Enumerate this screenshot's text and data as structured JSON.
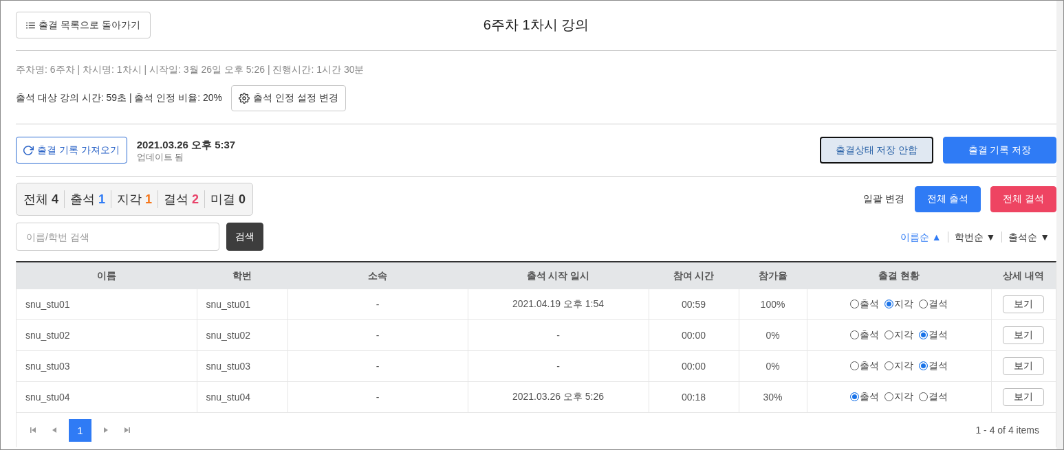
{
  "header": {
    "back_button": "출결 목록으로 돌아가기",
    "title": "6주차 1차시 강의"
  },
  "info": {
    "session_line": "주차명: 6주차 | 차시명: 1차시 | 시작일: 3월 26일 오후 5:26 | 진행시간: 1시간 30분",
    "criteria_line": "출석 대상 강의 시간: 59초 | 출석 인정 비율: 20%",
    "settings_button": "출석 인정 설정 변경"
  },
  "sync": {
    "fetch_button": "출결 기록 가져오기",
    "updated_time": "2021.03.26 오후 5:37",
    "updated_label": "업데이트 됨",
    "discard_button": {
      "label": "출결상태 저장 안함",
      "focused": true
    },
    "save_button": "출결 기록 저장"
  },
  "summary": [
    {
      "label": "전체",
      "count": "4",
      "color": "#333333"
    },
    {
      "label": "출석",
      "count": "1",
      "color": "#2f7bf5"
    },
    {
      "label": "지각",
      "count": "1",
      "color": "#f5761a"
    },
    {
      "label": "결석",
      "count": "2",
      "color": "#e8436a"
    },
    {
      "label": "미결",
      "count": "0",
      "color": "#333333"
    }
  ],
  "bulk_change": {
    "label": "일괄 변경",
    "buttons": [
      {
        "label": "전체 출석",
        "kind": "primary"
      },
      {
        "label": "전체 결석",
        "kind": "danger"
      }
    ]
  },
  "search": {
    "placeholder": "이름/학번 검색",
    "button": "검색"
  },
  "sort_options": [
    {
      "label": "이름순 ▲",
      "selected": true
    },
    {
      "label": "학번순 ▼",
      "selected": false
    },
    {
      "label": "출석순 ▼",
      "selected": false
    }
  ],
  "table": {
    "columns": [
      "이름",
      "학번",
      "소속",
      "출석 시작 일시",
      "참여 시간",
      "참가율",
      "출결 현황",
      "상세 내역"
    ],
    "rows": [
      {
        "name": "snu_stu01",
        "student_id": "snu_stu01",
        "affiliation": "-",
        "start_time": "2021.04.19 오후 1:54",
        "duration": "00:59",
        "rate": "100%",
        "attendance": [
          {
            "label": "출석",
            "selected": false
          },
          {
            "label": "지각",
            "selected": true
          },
          {
            "label": "결석",
            "selected": false
          }
        ],
        "detail_button": "보기"
      },
      {
        "name": "snu_stu02",
        "student_id": "snu_stu02",
        "affiliation": "-",
        "start_time": "-",
        "duration": "00:00",
        "rate": "0%",
        "attendance": [
          {
            "label": "출석",
            "selected": false
          },
          {
            "label": "지각",
            "selected": false
          },
          {
            "label": "결석",
            "selected": true
          }
        ],
        "detail_button": "보기"
      },
      {
        "name": "snu_stu03",
        "student_id": "snu_stu03",
        "affiliation": "-",
        "start_time": "-",
        "duration": "00:00",
        "rate": "0%",
        "attendance": [
          {
            "label": "출석",
            "selected": false
          },
          {
            "label": "지각",
            "selected": false
          },
          {
            "label": "결석",
            "selected": true
          }
        ],
        "detail_button": "보기"
      },
      {
        "name": "snu_stu04",
        "student_id": "snu_stu04",
        "affiliation": "-",
        "start_time": "2021.03.26 오후 5:26",
        "duration": "00:18",
        "rate": "30%",
        "attendance": [
          {
            "label": "출석",
            "selected": true
          },
          {
            "label": "지각",
            "selected": false
          },
          {
            "label": "결석",
            "selected": false
          }
        ],
        "detail_button": "보기"
      }
    ]
  },
  "pagination": {
    "pages": [
      {
        "label": "1",
        "selected": true
      }
    ],
    "summary": "1 - 4 of 4 items"
  }
}
